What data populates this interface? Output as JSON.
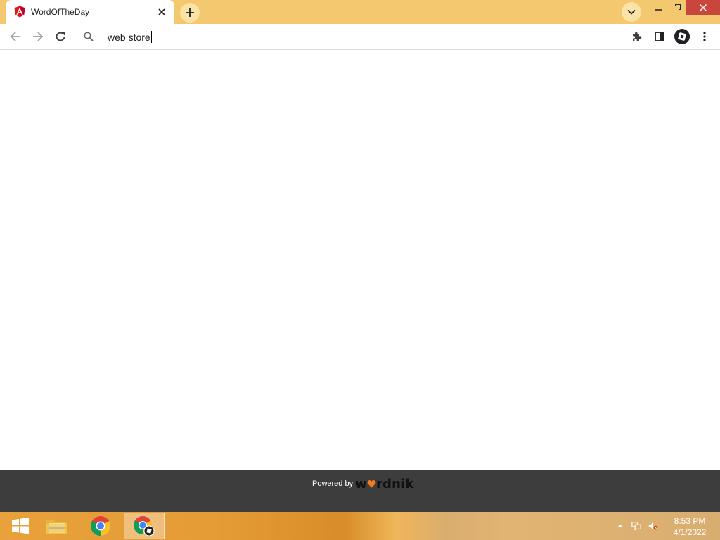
{
  "browser": {
    "tab": {
      "title": "WordOfTheDay",
      "favicon": "angular-icon"
    },
    "omnibox": {
      "value": "web store"
    },
    "colors": {
      "frame": "#f3c86e",
      "close": "#c9463d"
    }
  },
  "page": {
    "footer": {
      "powered_by": "Powered by",
      "brand": "wordnik"
    }
  },
  "taskbar": {
    "clock": {
      "time": "8:53 PM",
      "date": "4/1/2022"
    }
  }
}
